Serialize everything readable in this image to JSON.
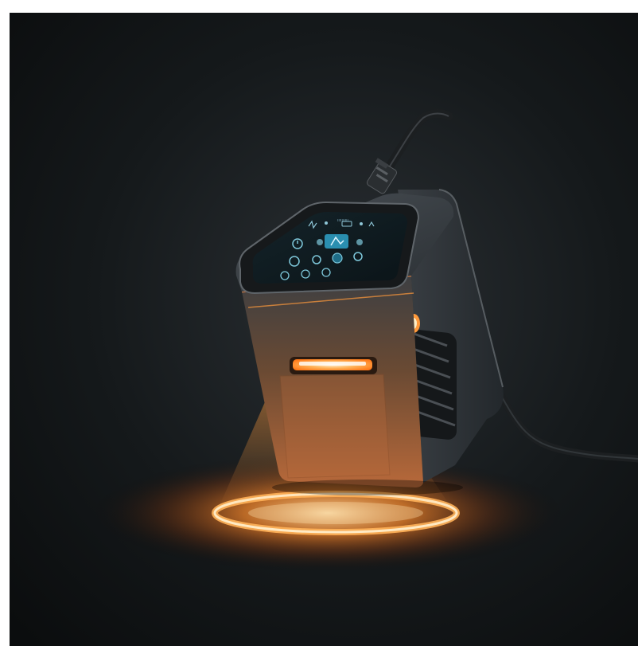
{
  "image": {
    "subject": "device",
    "background_color": "#0f1214",
    "glow_color": "#ff8a2a"
  },
  "device": {
    "screen_caption": "ıııııııııı",
    "icons": [
      "waveform-icon",
      "person-icon",
      "battery-icon",
      "dot-icon",
      "signal-icon",
      "power-icon",
      "play-icon",
      "settings-icon",
      "timer-icon",
      "minus-icon",
      "plus-icon",
      "mode-icon"
    ]
  }
}
